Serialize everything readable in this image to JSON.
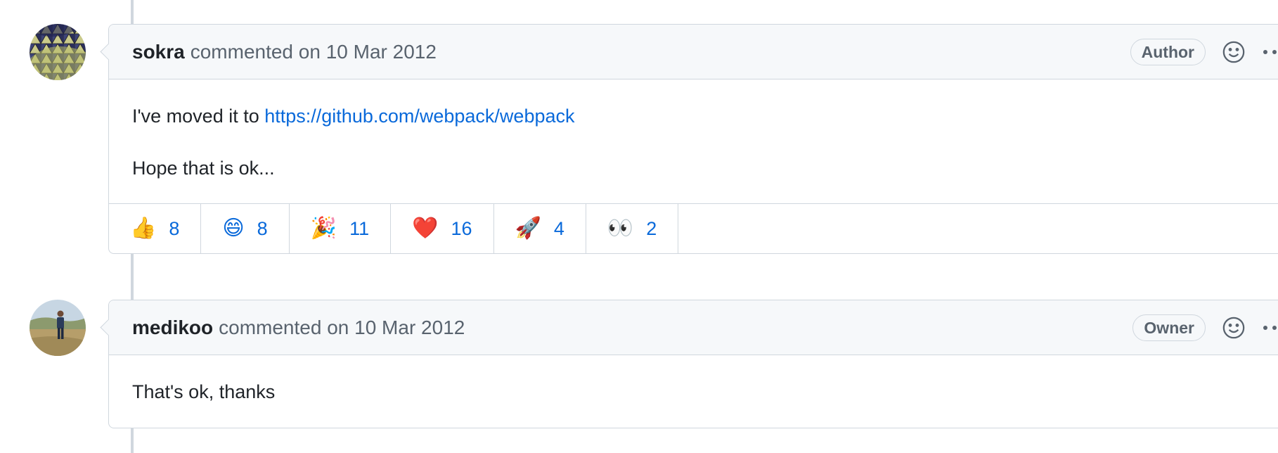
{
  "comments": [
    {
      "author": "sokra",
      "meta": "commented on 10 Mar 2012",
      "role": "Author",
      "body": {
        "prefix": "I've moved it to ",
        "link": "https://github.com/webpack/webpack",
        "line2": "Hope that is ok..."
      },
      "reactions": [
        {
          "emoji": "👍",
          "count": "8"
        },
        {
          "emoji": "😄",
          "count": "8"
        },
        {
          "emoji": "🎉",
          "count": "11"
        },
        {
          "emoji": "❤️",
          "count": "16"
        },
        {
          "emoji": "🚀",
          "count": "4"
        },
        {
          "emoji": "👀",
          "count": "2"
        }
      ]
    },
    {
      "author": "medikoo",
      "meta": "commented on 10 Mar 2012",
      "role": "Owner",
      "body": {
        "line1": "That's ok, thanks"
      }
    }
  ],
  "icons": {
    "add_reaction": "smiley-icon",
    "more": "kebab-horizontal-icon"
  },
  "colors": {
    "link": "#0969da",
    "border": "#d0d7de",
    "header_bg": "#f6f8fa",
    "muted": "#59636e"
  }
}
